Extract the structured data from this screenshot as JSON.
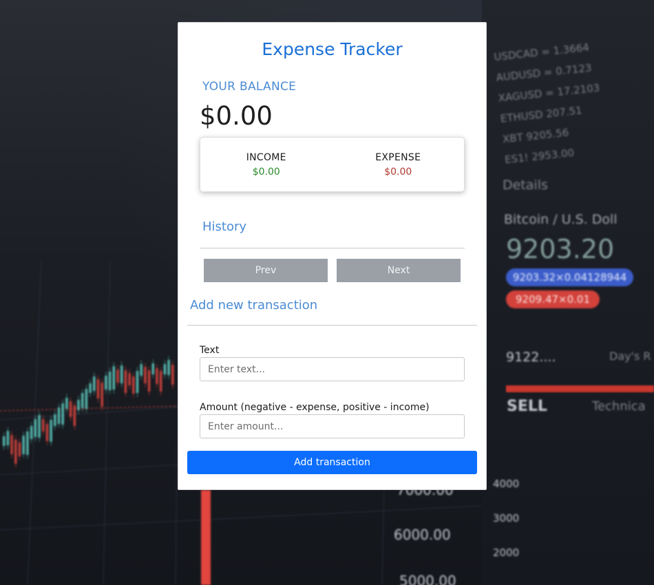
{
  "app": {
    "title": "Expense Tracker"
  },
  "balance": {
    "label": "YOUR BALANCE",
    "value": "$0.00"
  },
  "summary": {
    "income_label": "INCOME",
    "income_value": "$0.00",
    "expense_label": "EXPENSE",
    "expense_value": "$0.00"
  },
  "history": {
    "title": "History",
    "prev_label": "Prev",
    "next_label": "Next"
  },
  "form": {
    "title": "Add new transaction",
    "text_label": "Text",
    "text_placeholder": "Enter text...",
    "text_value": "",
    "amount_label": "Amount (negative - expense, positive - income)",
    "amount_placeholder": "Enter amount...",
    "amount_value": "",
    "submit_label": "Add transaction"
  },
  "background": {
    "ticker_lines": [
      "USDCAD = 1.3664",
      "AUDUSD = 0.7123",
      "XAGUSD = 17.2103",
      "ETHUSD  207.51",
      "XBT     9205.56",
      "ES1!    2953.00"
    ],
    "details_label": "Details",
    "pair_label": "Bitcoin / U.S. Doll",
    "price": "9203.20",
    "bid": "9203.32×0.04128944",
    "ask": "9209.47×0.01",
    "last": "9122....",
    "days_range": "Day's R",
    "sell_label": "SELL",
    "technicals_label": "Technica",
    "axis_values": [
      "7000.00",
      "6000.00",
      "5000.00"
    ],
    "mini_axis_values": [
      "4000",
      "3000",
      "2000"
    ]
  },
  "colors": {
    "accent": "#1a6fd6",
    "section_title": "#4b8bd4",
    "income": "#2b8a2b",
    "expense": "#b03a2e",
    "pager_button": "#9aa0a6",
    "submit_button": "#0d6efd"
  }
}
